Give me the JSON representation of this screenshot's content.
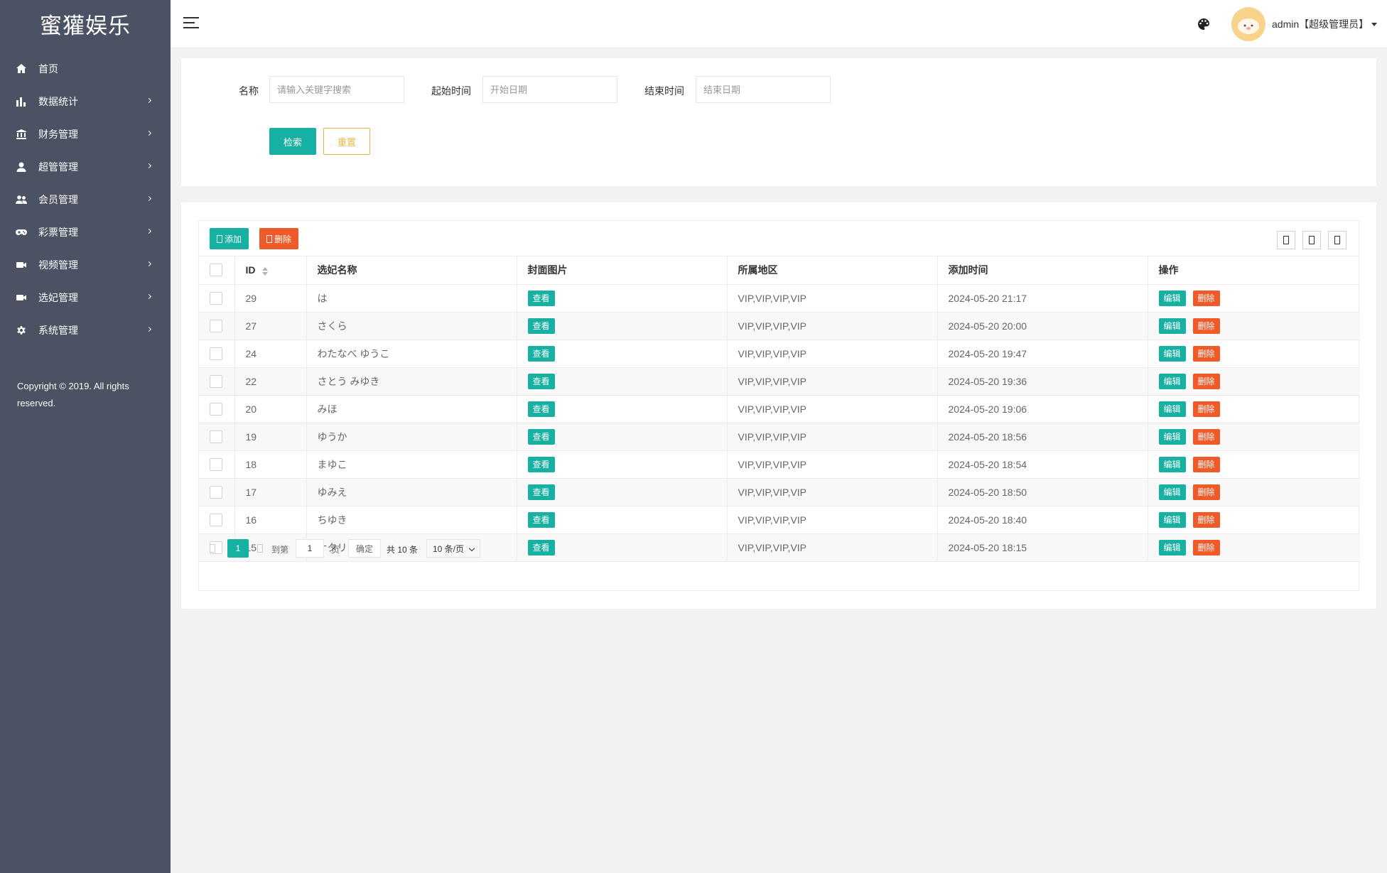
{
  "app": {
    "logo_text": "蜜獾娱乐"
  },
  "sidebar": {
    "items": [
      {
        "label": "首页",
        "icon": "home-icon",
        "has_arrow": false
      },
      {
        "label": "数据统计",
        "icon": "bar-chart-icon",
        "has_arrow": true
      },
      {
        "label": "财务管理",
        "icon": "bank-icon",
        "has_arrow": true
      },
      {
        "label": "超管管理",
        "icon": "user-icon",
        "has_arrow": true
      },
      {
        "label": "会员管理",
        "icon": "users-icon",
        "has_arrow": true
      },
      {
        "label": "彩票管理",
        "icon": "gamepad-icon",
        "has_arrow": true
      },
      {
        "label": "视频管理",
        "icon": "video-icon",
        "has_arrow": true
      },
      {
        "label": "选妃管理",
        "icon": "video-icon",
        "has_arrow": true
      },
      {
        "label": "系统管理",
        "icon": "gear-icon",
        "has_arrow": true
      }
    ],
    "copyright": "Copyright © 2019. All rights reserved."
  },
  "header": {
    "user_label": "admin【超级管理员】"
  },
  "search": {
    "name_label": "名称",
    "name_placeholder": "请输入关键字搜索",
    "start_label": "起始时间",
    "start_placeholder": "开始日期",
    "end_label": "结束时间",
    "end_placeholder": "结束日期",
    "search_button": "检索",
    "reset_button": "重置"
  },
  "toolbar": {
    "add_label": "添加",
    "delete_label": "删除"
  },
  "table": {
    "columns": [
      "ID",
      "选妃名称",
      "封面图片",
      "所属地区",
      "添加时间",
      "操作"
    ],
    "view_label": "查看",
    "edit_label": "编辑",
    "delete_label": "删除",
    "rows": [
      {
        "id": "29",
        "name": "は",
        "region": "VIP,VIP,VIP,VIP",
        "time": "2024-05-20 21:17"
      },
      {
        "id": "27",
        "name": "さくら",
        "region": "VIP,VIP,VIP,VIP",
        "time": "2024-05-20 20:00"
      },
      {
        "id": "24",
        "name": "わたなべ ゆうこ",
        "region": "VIP,VIP,VIP,VIP",
        "time": "2024-05-20 19:47"
      },
      {
        "id": "22",
        "name": "さとう みゆき",
        "region": "VIP,VIP,VIP,VIP",
        "time": "2024-05-20 19:36"
      },
      {
        "id": "20",
        "name": "みほ",
        "region": "VIP,VIP,VIP,VIP",
        "time": "2024-05-20 19:06"
      },
      {
        "id": "19",
        "name": "ゆうか",
        "region": "VIP,VIP,VIP,VIP",
        "time": "2024-05-20 18:56"
      },
      {
        "id": "18",
        "name": "まゆこ",
        "region": "VIP,VIP,VIP,VIP",
        "time": "2024-05-20 18:54"
      },
      {
        "id": "17",
        "name": "ゆみえ",
        "region": "VIP,VIP,VIP,VIP",
        "time": "2024-05-20 18:50"
      },
      {
        "id": "16",
        "name": "ちゆき",
        "region": "VIP,VIP,VIP,VIP",
        "time": "2024-05-20 18:40"
      },
      {
        "id": "15",
        "name": "ナタリー",
        "region": "VIP,VIP,VIP,VIP",
        "time": "2024-05-20 18:15"
      }
    ]
  },
  "pagination": {
    "current_page": "1",
    "goto_label": "到第",
    "goto_value": "1",
    "page_unit": "页",
    "confirm_label": "确定",
    "total_label": "共 10 条",
    "page_size": "10 条/页"
  },
  "colors": {
    "primary": "#16b1a2",
    "danger": "#f05a28",
    "warning": "#e6b64c",
    "sidebar": "#4a5263"
  }
}
